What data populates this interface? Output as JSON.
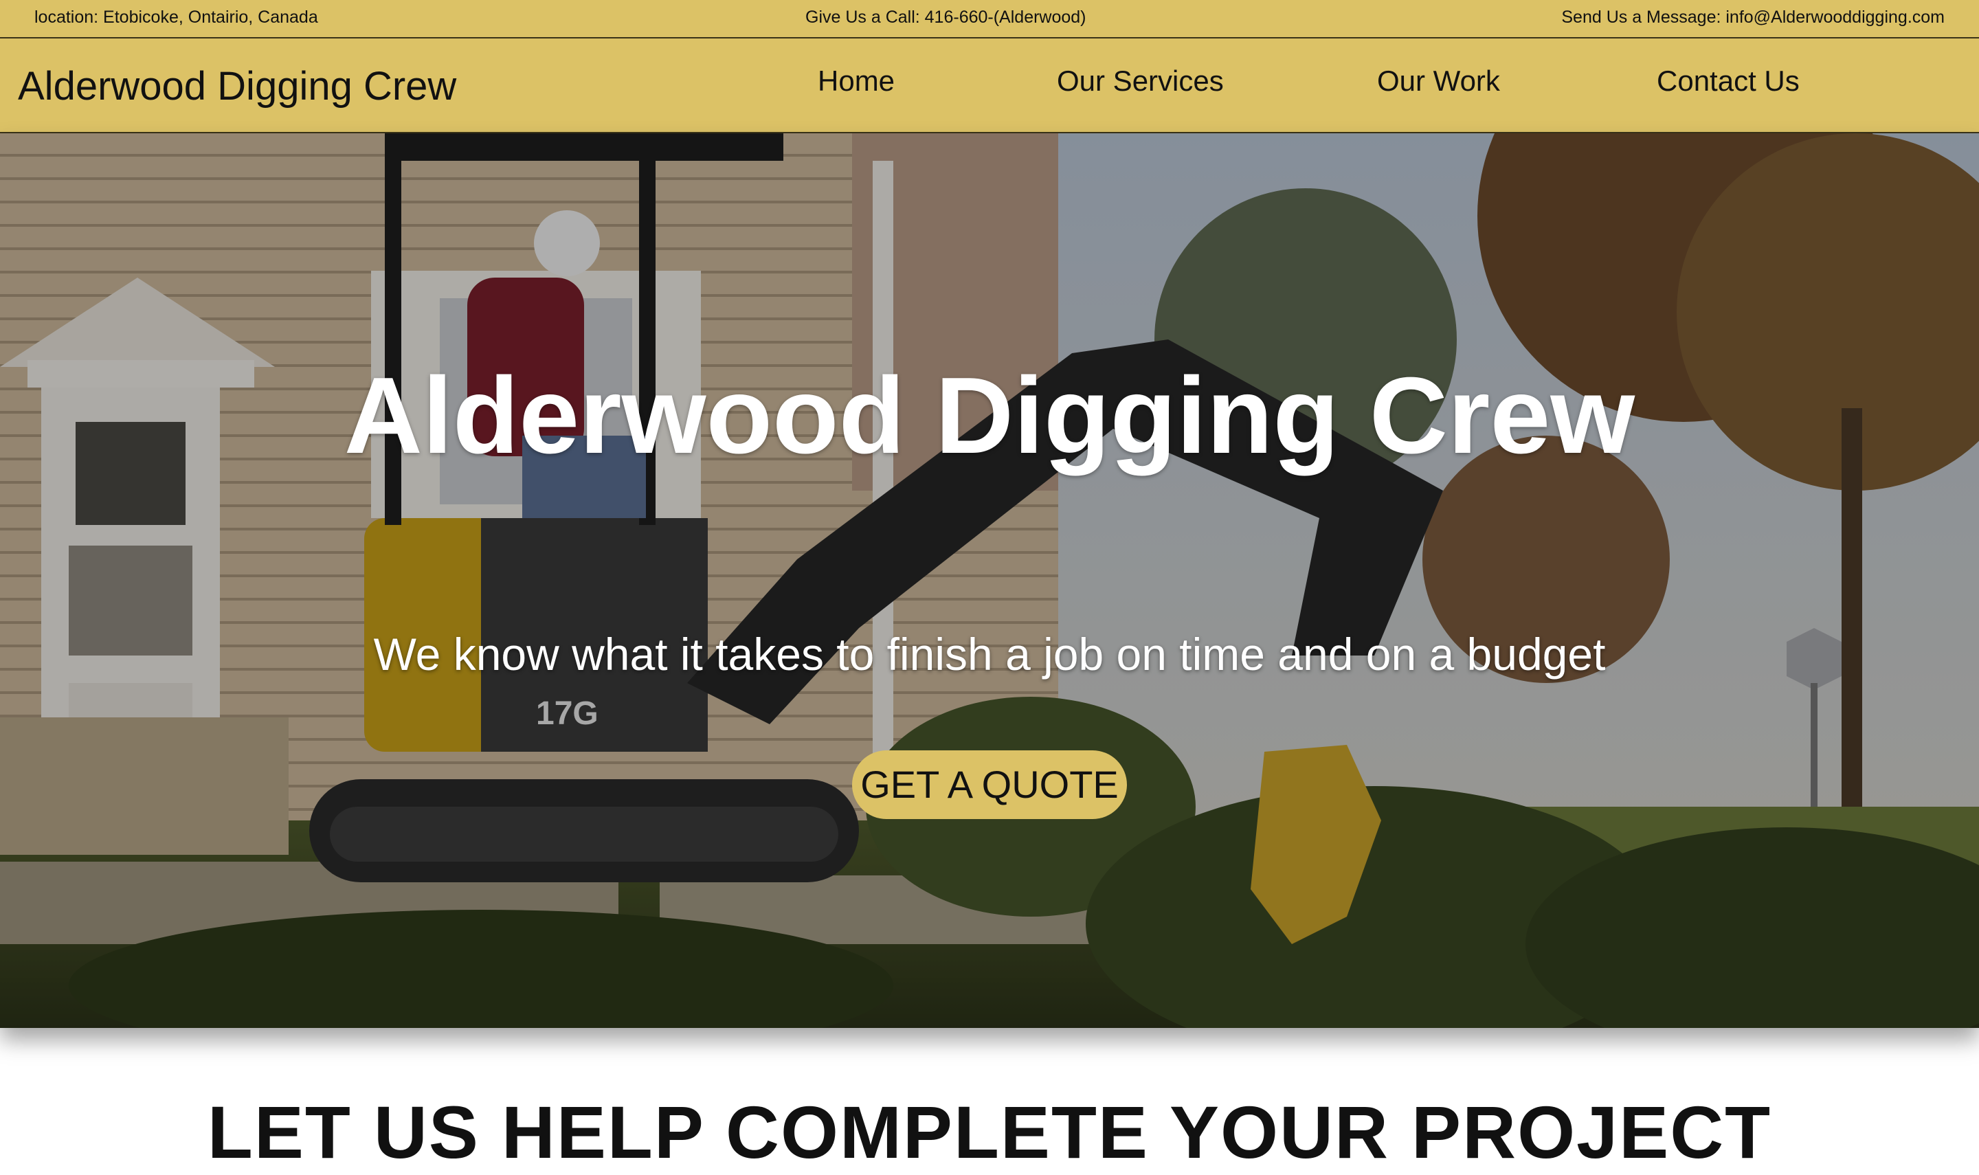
{
  "topbar": {
    "location": "location: Etobicoke, Ontairio, Canada",
    "call": "Give Us a Call: 416-660-(Alderwood)",
    "message": "Send Us a Message: info@Alderwooddigging.com"
  },
  "nav": {
    "brand": "Alderwood Digging Crew",
    "items": [
      {
        "label": "Home"
      },
      {
        "label": "Our Services"
      },
      {
        "label": "Our Work"
      },
      {
        "label": "Contact Us"
      }
    ]
  },
  "hero": {
    "title": "Alderwood Digging Crew",
    "subtitle": "We know what it takes to finish a job on time and on a budget",
    "cta": "GET A QUOTE",
    "machine_label": "17G"
  },
  "section": {
    "heading": "LET US HELP COMPLETE YOUR PROJECT"
  },
  "colors": {
    "accent": "#dcc266",
    "text_dark": "#111111",
    "hero_text": "#ffffff"
  }
}
